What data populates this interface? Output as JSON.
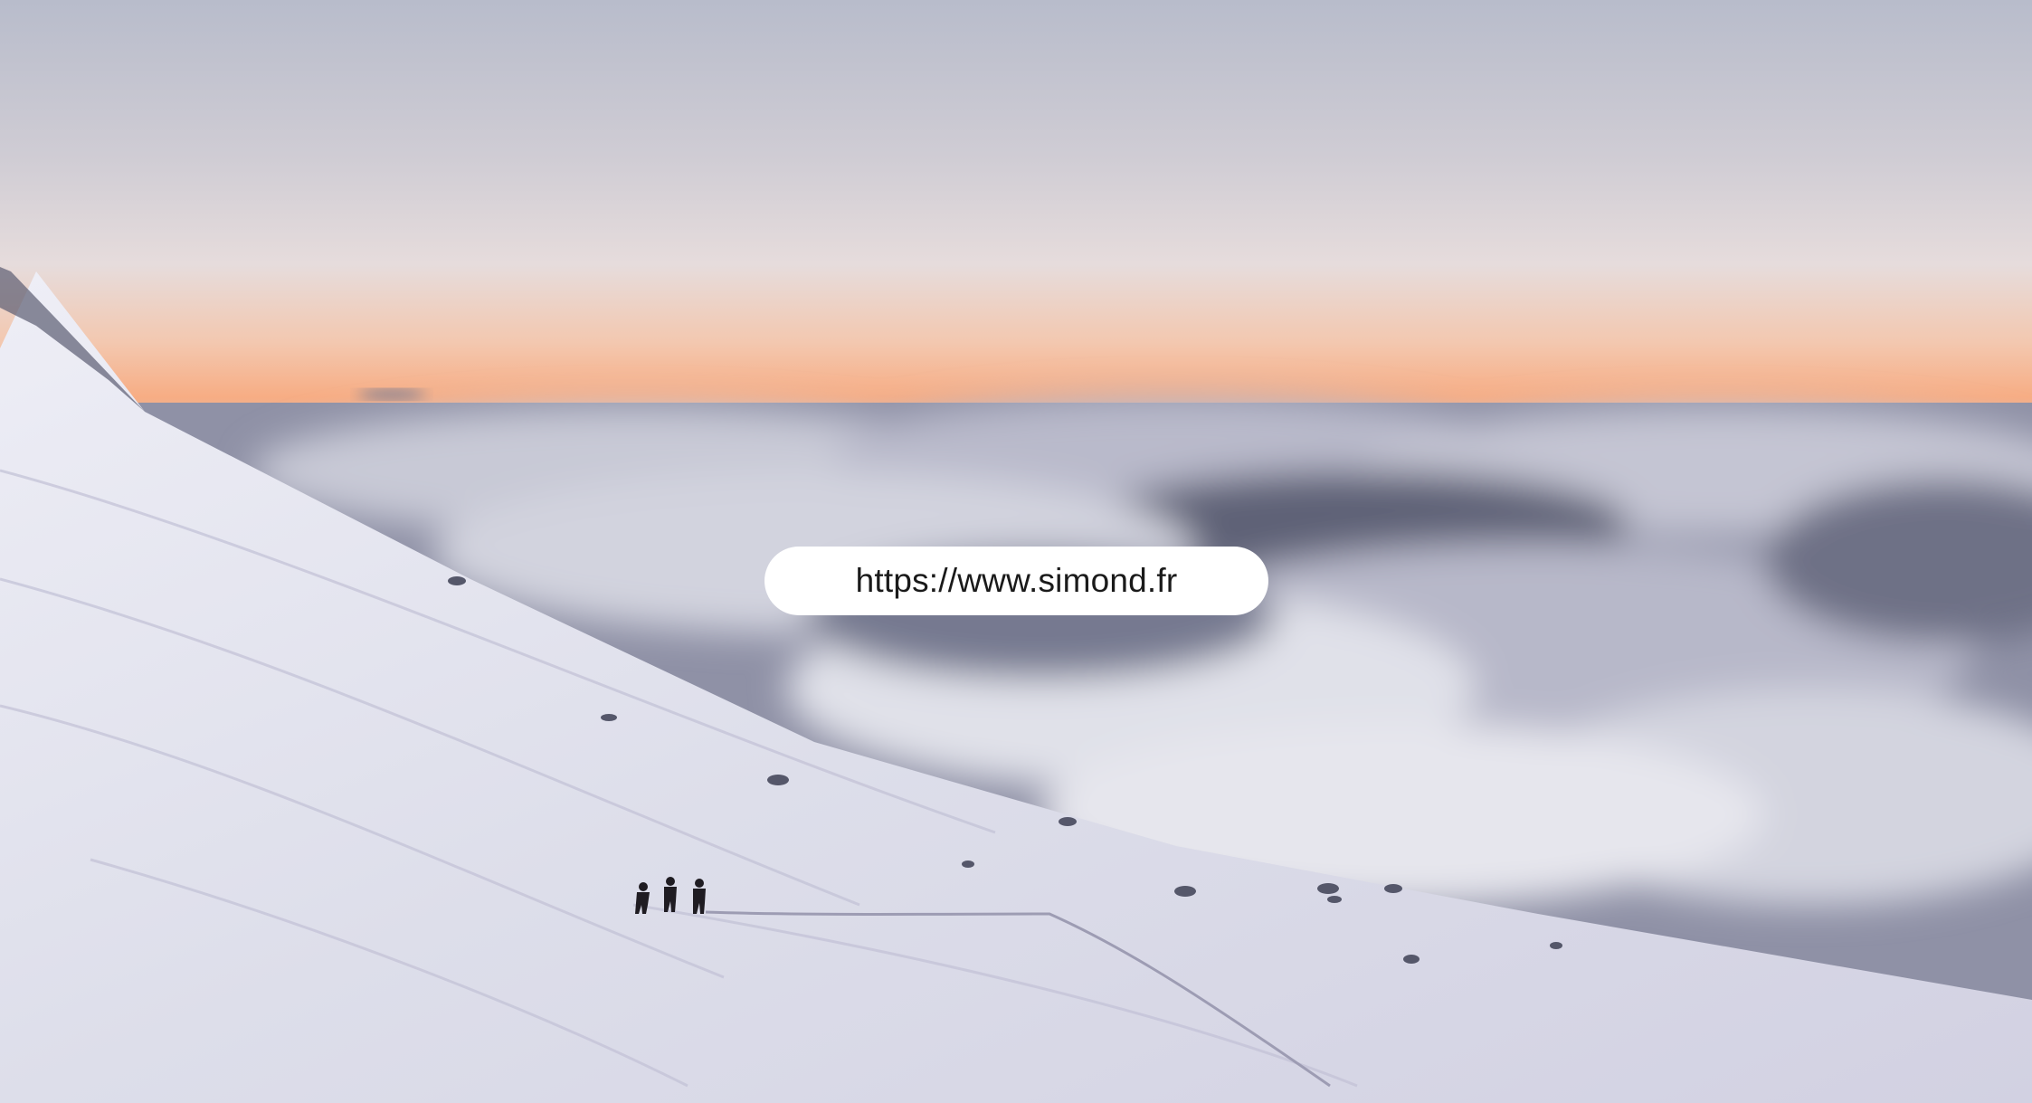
{
  "overlay": {
    "url_text": "https://www.simond.fr"
  },
  "palette": {
    "sky_top": "#b9bccb",
    "sky_mid": "#e7dede",
    "horizon_glow": "#f5a97f",
    "cloud_light": "#e4e5ec",
    "cloud_shadow": "#6d7083",
    "snow_light": "#ebeaf3",
    "snow_shadow": "#b7b6cc",
    "climber": "#1f1c22"
  }
}
